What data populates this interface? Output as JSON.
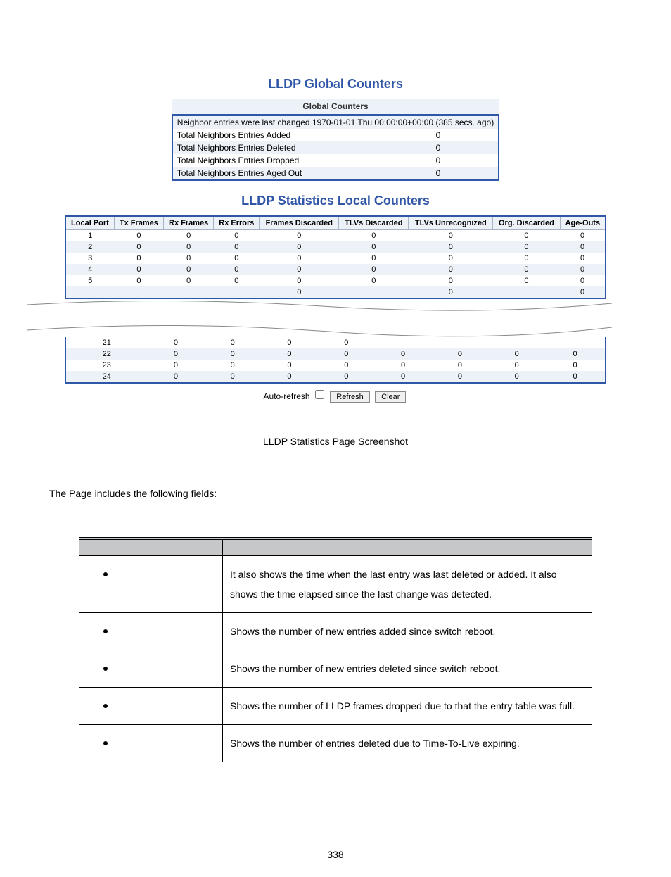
{
  "title_global": "LLDP Global Counters",
  "title_local": "LLDP Statistics Local Counters",
  "global_caption": "Global Counters",
  "global_banner": "Neighbor entries were last changed  1970-01-01 Thu 00:00:00+00:00 (385 secs. ago)",
  "global_rows": [
    {
      "label": "Total Neighbors Entries Added",
      "value": "0"
    },
    {
      "label": "Total Neighbors Entries Deleted",
      "value": "0"
    },
    {
      "label": "Total Neighbors Entries Dropped",
      "value": "0"
    },
    {
      "label": "Total Neighbors Entries Aged Out",
      "value": "0"
    }
  ],
  "local_headers": [
    "Local Port",
    "Tx Frames",
    "Rx Frames",
    "Rx Errors",
    "Frames Discarded",
    "TLVs Discarded",
    "TLVs Unrecognized",
    "Org. Discarded",
    "Age-Outs"
  ],
  "local_rows_top": [
    {
      "port": "1",
      "tx": "0",
      "rx": "0",
      "rxerr": "0",
      "fd": "0",
      "td": "0",
      "tu": "0",
      "od": "0",
      "ao": "0"
    },
    {
      "port": "2",
      "tx": "0",
      "rx": "0",
      "rxerr": "0",
      "fd": "0",
      "td": "0",
      "tu": "0",
      "od": "0",
      "ao": "0"
    },
    {
      "port": "3",
      "tx": "0",
      "rx": "0",
      "rxerr": "0",
      "fd": "0",
      "td": "0",
      "tu": "0",
      "od": "0",
      "ao": "0"
    },
    {
      "port": "4",
      "tx": "0",
      "rx": "0",
      "rxerr": "0",
      "fd": "0",
      "td": "0",
      "tu": "0",
      "od": "0",
      "ao": "0"
    },
    {
      "port": "5",
      "tx": "0",
      "rx": "0",
      "rxerr": "0",
      "fd": "0",
      "td": "0",
      "tu": "0",
      "od": "0",
      "ao": "0"
    }
  ],
  "local_rows_mid_partial": [
    {
      "port": "",
      "tx": "",
      "rx": "",
      "rxerr": "",
      "fd": "0",
      "td": "",
      "tu": "0",
      "od": "",
      "ao": "0"
    }
  ],
  "local_rows_bot": [
    {
      "port": "21",
      "tx": "0",
      "rx": "0",
      "rxerr": "0",
      "fd": "0",
      "td": "",
      "tu": "",
      "od": "",
      "ao": ""
    },
    {
      "port": "22",
      "tx": "0",
      "rx": "0",
      "rxerr": "0",
      "fd": "0",
      "td": "0",
      "tu": "0",
      "od": "0",
      "ao": "0"
    },
    {
      "port": "23",
      "tx": "0",
      "rx": "0",
      "rxerr": "0",
      "fd": "0",
      "td": "0",
      "tu": "0",
      "od": "0",
      "ao": "0"
    },
    {
      "port": "24",
      "tx": "0",
      "rx": "0",
      "rxerr": "0",
      "fd": "0",
      "td": "0",
      "tu": "0",
      "od": "0",
      "ao": "0"
    }
  ],
  "auto_refresh_label": "Auto-refresh",
  "refresh_label": "Refresh",
  "clear_label": "Clear",
  "screenshot_caption": "LLDP Statistics Page Screenshot",
  "fields_intro": "The Page includes the following fields:",
  "fields_rows": [
    {
      "desc": "It also shows the time when the last entry was last deleted or added. It also shows the time elapsed since the last change was detected."
    },
    {
      "desc": "Shows the number of new entries added since switch reboot."
    },
    {
      "desc": "Shows the number of new entries deleted since switch reboot."
    },
    {
      "desc": "Shows the number of LLDP frames dropped due to that the entry table was full."
    },
    {
      "desc": "Shows the number of entries deleted due to Time-To-Live expiring."
    }
  ],
  "page_number": "338"
}
